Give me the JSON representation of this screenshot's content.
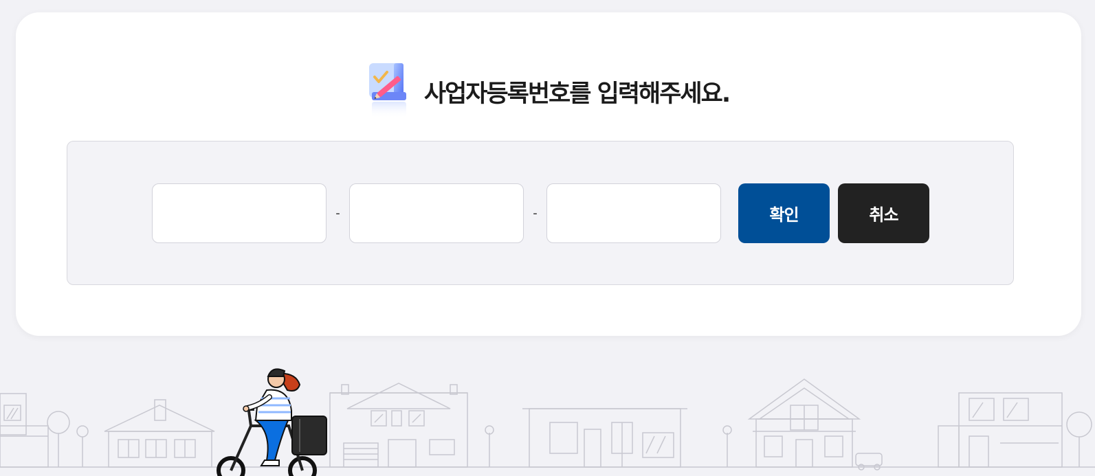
{
  "page": {
    "title": "사업자등록번호를 입력해주세요.",
    "title_icon": "pencil-checklist-icon"
  },
  "form": {
    "fields": [
      {
        "value": ""
      },
      {
        "value": ""
      },
      {
        "value": ""
      }
    ],
    "separator": "-",
    "confirm_label": "확인",
    "cancel_label": "취소"
  },
  "colors": {
    "background": "#f2f2f6",
    "confirm_button": "#004f97",
    "cancel_button": "#222222",
    "bike_rider_pants": "#0b6fe0"
  },
  "illustration": {
    "name": "town-delivery-scene",
    "icons": [
      "houses-icon",
      "delivery-rider-icon"
    ]
  }
}
